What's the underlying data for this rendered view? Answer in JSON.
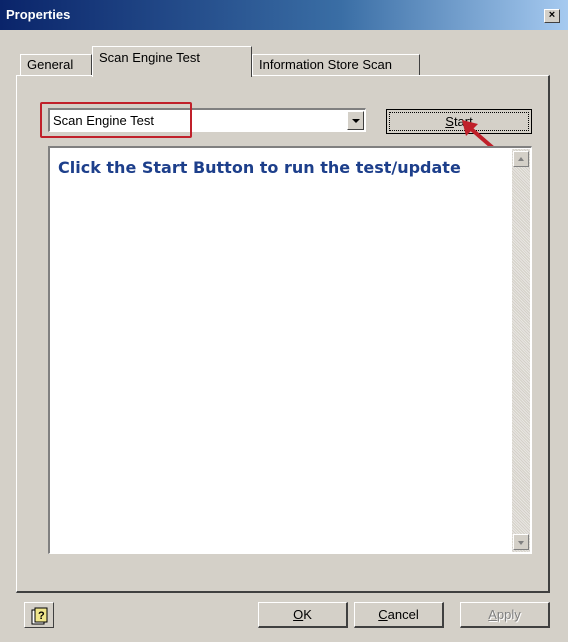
{
  "window": {
    "title": "Properties",
    "close_label": "×"
  },
  "tabs": [
    {
      "label": "General",
      "active": false
    },
    {
      "label": "Scan Engine Test",
      "active": true
    },
    {
      "label": "Information Store Scan",
      "active": false
    }
  ],
  "combo": {
    "value": "Scan Engine Test"
  },
  "start_button": {
    "label_mnemonic": "S",
    "label_rest": "tart"
  },
  "output": {
    "message": "Click the Start Button to run the test/update"
  },
  "footer": {
    "ok_mnemonic": "O",
    "ok_rest": "K",
    "cancel_mnemonic": "C",
    "cancel_rest": "ancel",
    "apply_mnemonic": "A",
    "apply_rest": "pply",
    "apply_enabled": false
  },
  "colors": {
    "highlight": "#c0202a",
    "message_text": "#1d3f8b",
    "title_bar": "#0a246a"
  },
  "icons": {
    "help": "help-question-icon",
    "arrow": "annotation-arrow"
  }
}
